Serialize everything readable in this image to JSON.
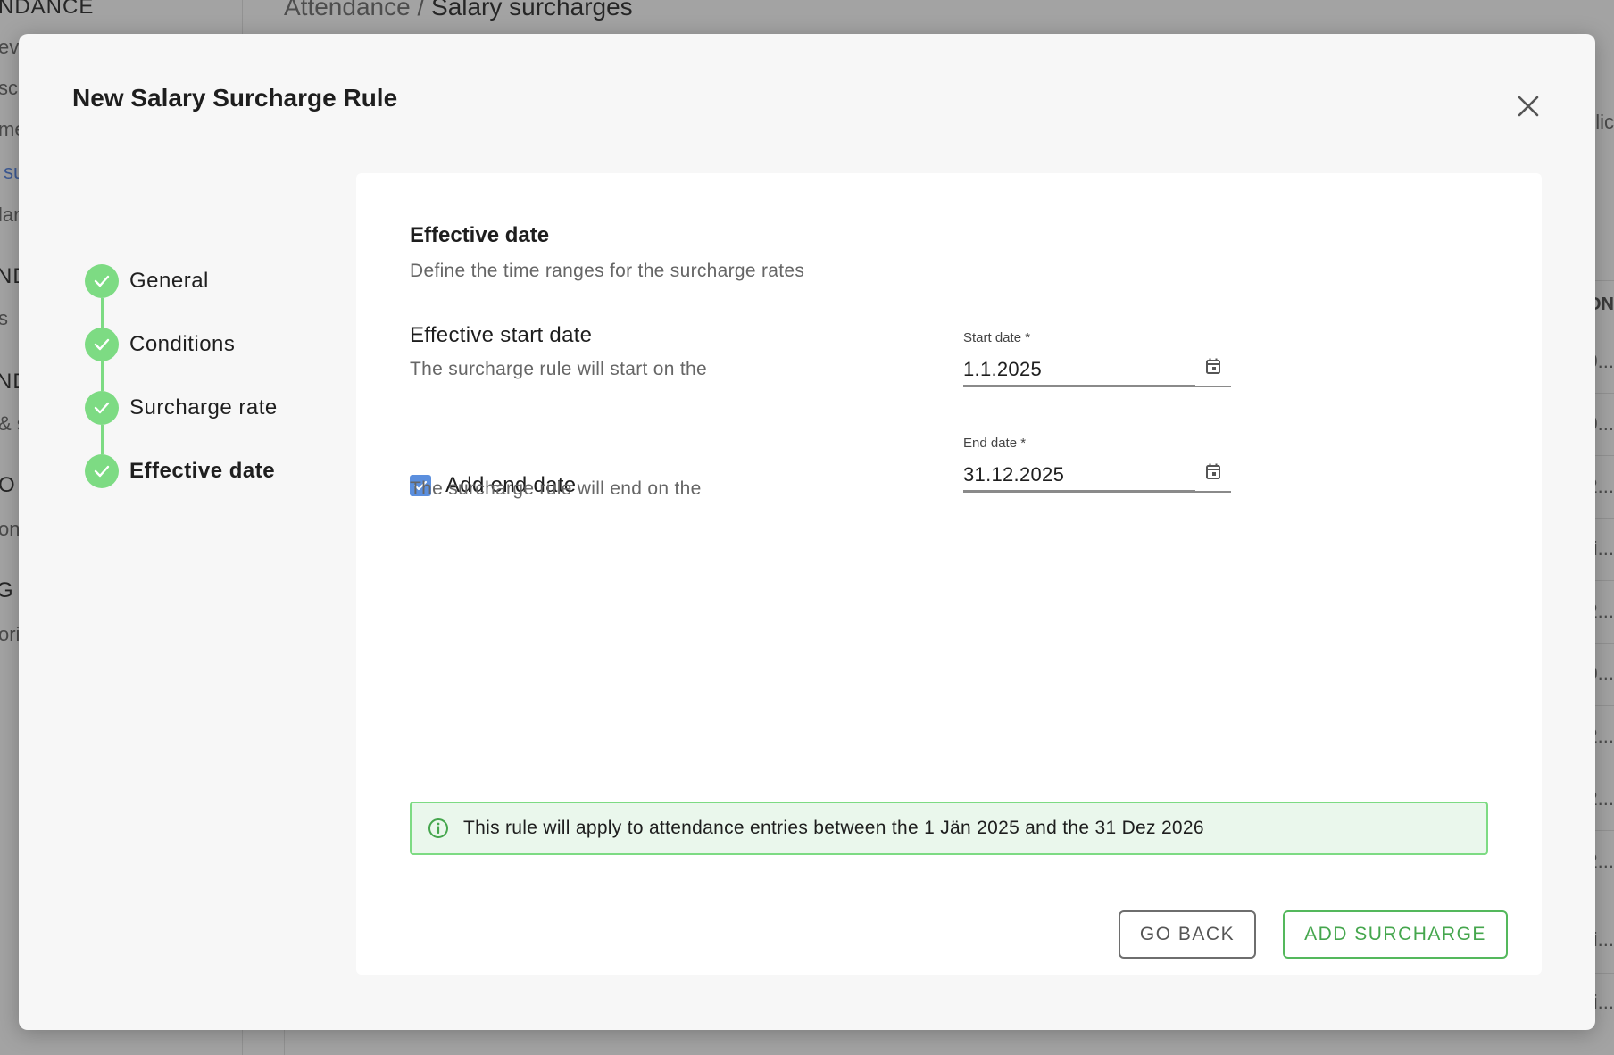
{
  "background": {
    "breadcrumb": {
      "parent": "Attendance",
      "separator": " / ",
      "current": "Salary surcharges"
    },
    "sidebar_fragments": [
      {
        "text": "NDANCE",
        "kind": "head"
      },
      {
        "text": "ev",
        "kind": "item"
      },
      {
        "text": "sc",
        "kind": "item"
      },
      {
        "text": "me",
        "kind": "item"
      },
      {
        "text": "su",
        "kind": "active"
      },
      {
        "text": "lar",
        "kind": "item"
      },
      {
        "text": "ND",
        "kind": "head"
      },
      {
        "text": "s",
        "kind": "item"
      },
      {
        "text": "ND",
        "kind": "head"
      },
      {
        "text": "& s",
        "kind": "item"
      },
      {
        "text": "O",
        "kind": "head"
      },
      {
        "text": "on",
        "kind": "item"
      },
      {
        "text": "G",
        "kind": "head"
      },
      {
        "text": "ori",
        "kind": "item"
      }
    ],
    "right_column_header": "ON",
    "right_edge_fragments": [
      "olic",
      "0...",
      "0...",
      "2...",
      "oli...",
      "2...",
      "0...",
      "2...",
      "2...",
      "2...",
      "oli...",
      "oli..."
    ]
  },
  "modal": {
    "title": "New Salary Surcharge Rule",
    "close_icon": "close-icon",
    "steps": [
      {
        "label": "General",
        "status": "complete",
        "current": false
      },
      {
        "label": "Conditions",
        "status": "complete",
        "current": false
      },
      {
        "label": "Surcharge rate",
        "status": "complete",
        "current": false
      },
      {
        "label": "Effective date",
        "status": "complete",
        "current": true
      }
    ],
    "section": {
      "title": "Effective date",
      "subtitle": "Define the time ranges for the surcharge rates"
    },
    "start": {
      "title": "Effective start date",
      "description": "The surcharge rule will start on the",
      "field_label": "Start date *",
      "value": "1.1.2025"
    },
    "end": {
      "checkbox_label": "Add end date",
      "checked": true,
      "description": "The surcharge rule will end on the",
      "field_label": "End date *",
      "value": "31.12.2025"
    },
    "info_banner": "This rule will apply to attendance entries between the 1 Jän 2025 and the 31 Dez 2026",
    "buttons": {
      "back": "GO BACK",
      "add": "ADD SURCHARGE"
    },
    "colors": {
      "accent_green": "#7ddb83",
      "button_green": "#45a64d",
      "checkbox_blue": "#5b8fde",
      "banner_bg": "#eaf7ec"
    }
  }
}
